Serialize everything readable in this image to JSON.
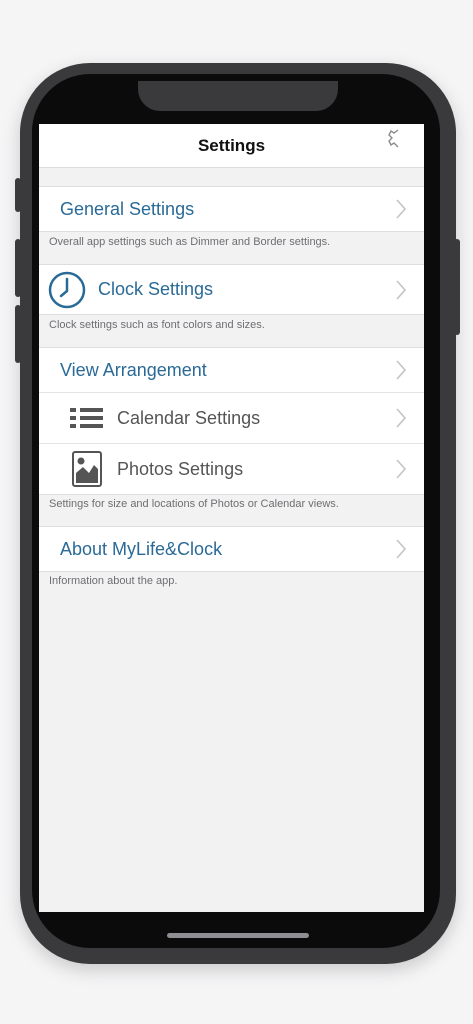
{
  "navbar": {
    "title": "Settings"
  },
  "sections": {
    "general": {
      "label": "General Settings",
      "footer": "Overall app settings such as Dimmer and Border settings."
    },
    "clock": {
      "label": "Clock Settings",
      "footer": "Clock settings such as font colors and sizes."
    },
    "view": {
      "header_label": "View Arrangement",
      "calendar_label": "Calendar Settings",
      "photos_label": "Photos Settings",
      "footer": "Settings for size and locations of Photos or Calendar views."
    },
    "about": {
      "label": "About MyLife&Clock",
      "footer": "Information about the app."
    }
  },
  "colors": {
    "accent": "#2a6a96",
    "icon_gray": "#555555"
  }
}
